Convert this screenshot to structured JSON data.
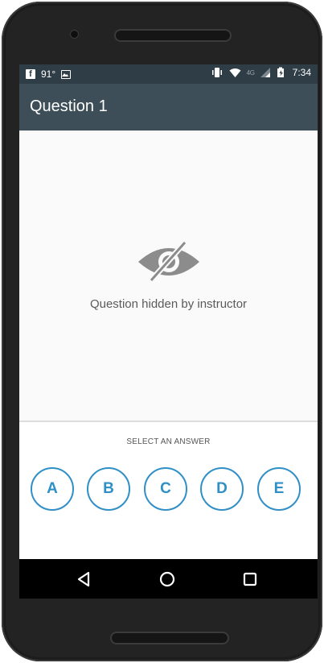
{
  "status_bar": {
    "left_temp": "91°",
    "net_label": "4G",
    "time": "7:34",
    "icons": [
      "facebook-icon",
      "image-icon",
      "vibrate-icon",
      "wifi-icon",
      "signal-icon",
      "battery-charging-icon"
    ]
  },
  "app_bar": {
    "title": "Question 1"
  },
  "content": {
    "icon": "eye-off-icon",
    "message": "Question hidden by instructor"
  },
  "answer": {
    "prompt": "SELECT AN ANSWER",
    "choices": [
      "A",
      "B",
      "C",
      "D",
      "E"
    ]
  },
  "nav_bar": {
    "buttons": [
      "back-icon",
      "home-icon",
      "recents-icon"
    ]
  },
  "colors": {
    "status_bar": "#2e3d46",
    "app_bar": "#3d4e58",
    "accent": "#2f8fc6",
    "icon_gray": "#888888"
  }
}
